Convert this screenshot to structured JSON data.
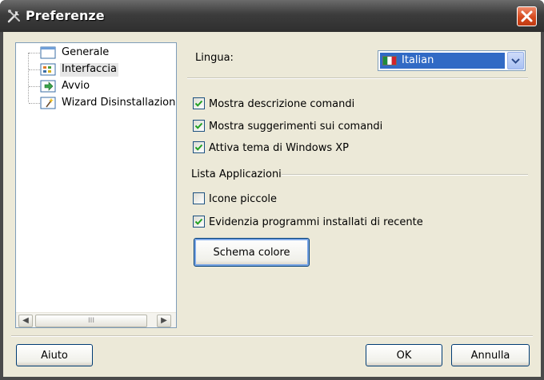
{
  "window": {
    "title": "Preferenze"
  },
  "tree": {
    "items": [
      {
        "label": "Generale",
        "icon": "generale-icon",
        "selected": false
      },
      {
        "label": "Interfaccia",
        "icon": "interfaccia-icon",
        "selected": true
      },
      {
        "label": "Avvio",
        "icon": "avvio-icon",
        "selected": false
      },
      {
        "label": "Wizard Disinstallazione",
        "icon": "wizard-icon",
        "selected": false
      }
    ],
    "scroll_left": "◀",
    "scroll_right": "▶",
    "scroll_thumb_grip": "III"
  },
  "settings": {
    "language_label": "Lingua:",
    "language_value": "Italian",
    "checkboxes": [
      {
        "label": "Mostra descrizione comandi",
        "checked": true
      },
      {
        "label": "Mostra suggerimenti sui comandi",
        "checked": true
      },
      {
        "label": "Attiva tema di Windows XP",
        "checked": true
      }
    ],
    "app_list_title": "Lista Applicazioni",
    "app_checkboxes": [
      {
        "label": "Icone piccole",
        "checked": false
      },
      {
        "label": "Evidenzia programmi installati di recente",
        "checked": true
      }
    ],
    "color_scheme_label": "Schema colore"
  },
  "footer": {
    "help_label": "Aiuto",
    "ok_label": "OK",
    "cancel_label": "Annulla"
  },
  "colors": {
    "titlebar": "#3c3c3c",
    "client": "#ece9d8",
    "selection": "#316ac5",
    "close": "#d64a1e"
  }
}
